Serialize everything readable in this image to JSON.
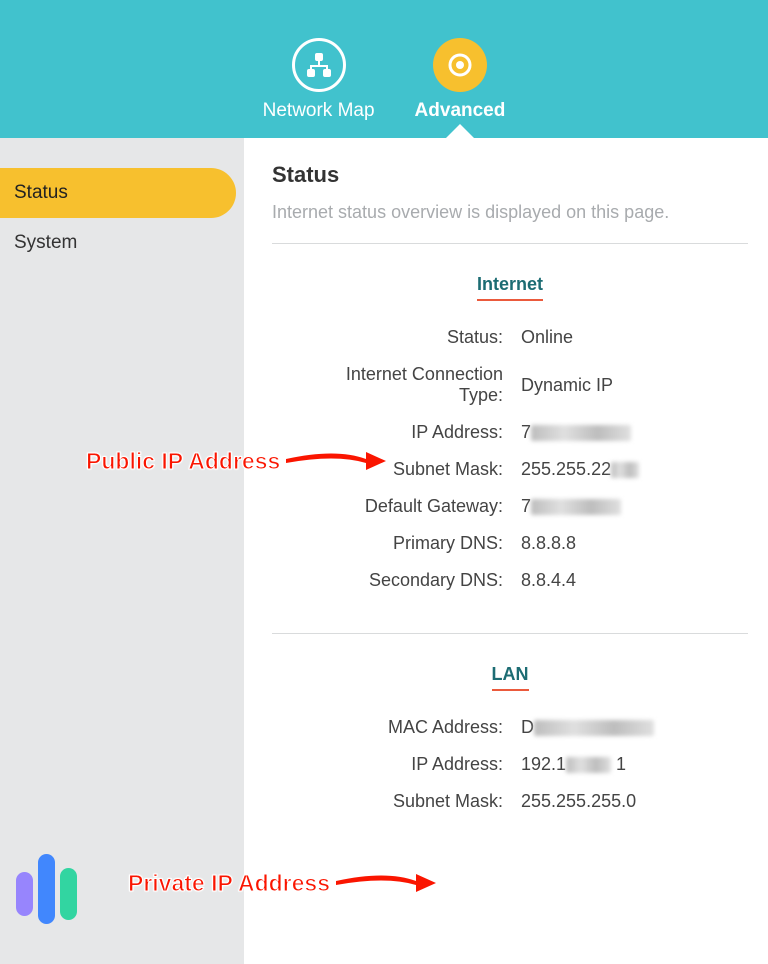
{
  "header": {
    "tabs": [
      {
        "id": "network-map",
        "label": "Network Map",
        "active": false
      },
      {
        "id": "advanced",
        "label": "Advanced",
        "active": true
      }
    ]
  },
  "sidebar": {
    "items": [
      {
        "id": "status",
        "label": "Status",
        "selected": true
      },
      {
        "id": "system",
        "label": "System",
        "selected": false
      }
    ]
  },
  "page": {
    "title": "Status",
    "description": "Internet status overview is displayed on this page."
  },
  "sections": {
    "internet": {
      "title": "Internet",
      "rows": {
        "status": {
          "label": "Status:",
          "value": "Online"
        },
        "conn_type": {
          "label": "Internet Connection Type:",
          "value": "Dynamic IP"
        },
        "ip": {
          "label": "IP Address:",
          "value": "7",
          "partial_blur": true,
          "blur_w": 100
        },
        "subnet": {
          "label": "Subnet Mask:",
          "value": "255.255.22",
          "partial_blur": true,
          "blur_w": 28
        },
        "gateway": {
          "label": "Default Gateway:",
          "value": "7",
          "partial_blur": true,
          "blur_w": 90
        },
        "dns1": {
          "label": "Primary DNS:",
          "value": "8.8.8.8"
        },
        "dns2": {
          "label": "Secondary DNS:",
          "value": "8.8.4.4"
        }
      }
    },
    "lan": {
      "title": "LAN",
      "rows": {
        "mac": {
          "label": "MAC Address:",
          "value": "D",
          "partial_blur": true,
          "blur_w": 120
        },
        "ip": {
          "label": "IP Address:",
          "value_parts": [
            "192.1",
            " 1"
          ],
          "partial_blur_mid": true,
          "blur_w": 45
        },
        "subnet": {
          "label": "Subnet Mask:",
          "value": "255.255.255.0"
        }
      }
    }
  },
  "annotations": {
    "public": {
      "text": "Public IP Address"
    },
    "private": {
      "text": "Private IP Address"
    }
  }
}
